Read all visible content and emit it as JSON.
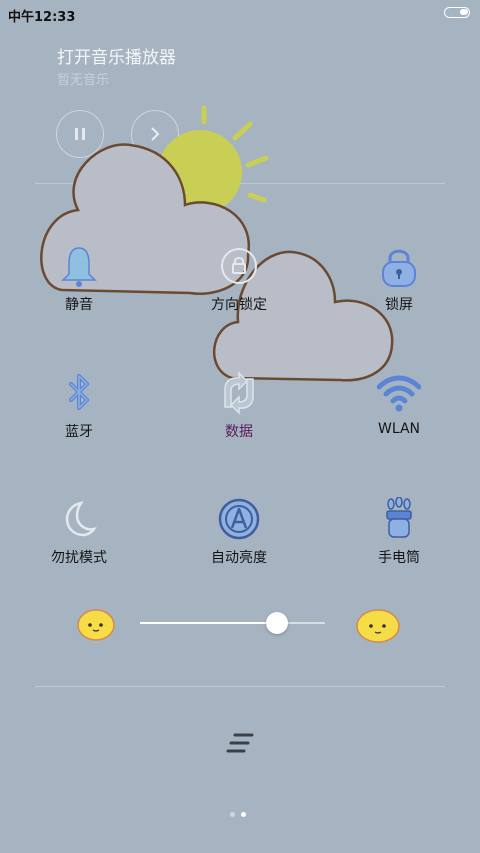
{
  "status_bar": {
    "time": "中午12:33",
    "battery_icon": "battery-icon"
  },
  "music": {
    "title": "打开音乐播放器",
    "subtitle": "暂无音乐",
    "pause_icon": "pause-icon",
    "next_icon": "next-icon"
  },
  "weather": {
    "icons": [
      "sun-icon",
      "cloud-icon",
      "cloud-icon"
    ]
  },
  "toggles": [
    {
      "label": "静音",
      "icon": "bell-icon",
      "active": true
    },
    {
      "label": "方向锁定",
      "icon": "rotation-lock-icon",
      "active": false
    },
    {
      "label": "锁屏",
      "icon": "lock-icon",
      "active": true
    },
    {
      "label": "蓝牙",
      "icon": "bluetooth-icon",
      "active": true
    },
    {
      "label": "数据",
      "icon": "mobile-data-icon",
      "active": false
    },
    {
      "label": "WLAN",
      "icon": "wifi-icon",
      "active": true
    },
    {
      "label": "勿扰模式",
      "icon": "moon-icon",
      "active": false
    },
    {
      "label": "自动亮度",
      "icon": "auto-brightness-icon",
      "active": true
    },
    {
      "label": "手电筒",
      "icon": "flashlight-icon",
      "active": true
    }
  ],
  "brightness": {
    "level": 0.74,
    "low_icon": "brightness-low-face-icon",
    "high_icon": "brightness-high-face-icon"
  },
  "colors": {
    "accent": "#5b84d6",
    "icon_fill": "#8fb0e3",
    "background": "#a6b4c2",
    "inactive": "#e4e9ee",
    "data_label": "#5a1a5a"
  },
  "pager": {
    "pages": 2,
    "current": 2
  }
}
